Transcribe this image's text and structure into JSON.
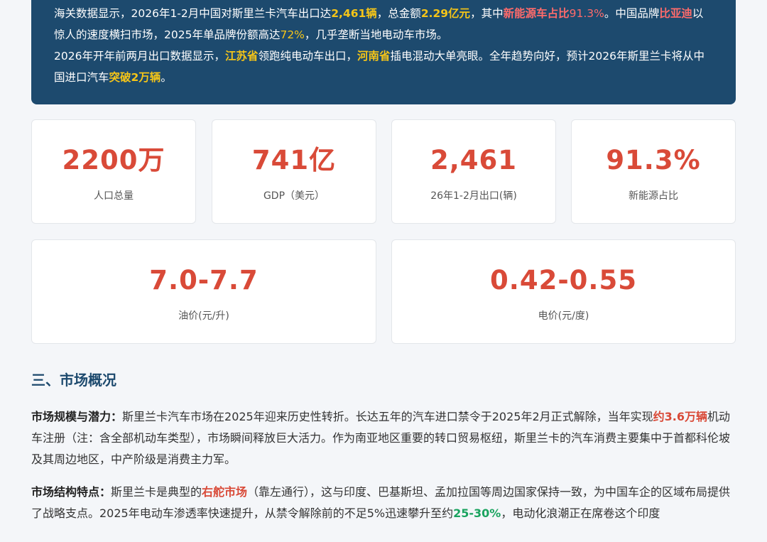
{
  "hero": {
    "p1": {
      "t1": "海关数据显示，2026年1-2月中国对斯里兰卡汽车出口达",
      "h1": "2,461辆",
      "t2": "，总金额",
      "h2": "2.29亿元",
      "t3": "，其中",
      "h3": "新能源车占比",
      "h3b": "91.3%",
      "t4": "。中国品牌",
      "h4": "比亚迪",
      "t5": "以惊人的速度横扫市场，2025年单品牌份额高达",
      "h5": "72%",
      "t6": "，几乎垄断当地电动车市场。"
    },
    "p2": {
      "t1": "2026年开年前两月出口数据显示，",
      "h1": "江苏省",
      "t2": "领跑纯电动车出口，",
      "h2": "河南省",
      "t3": "插电混动大单亮眼。全年趋势向好，预计2026年斯里兰卡将从中国进口汽车",
      "h3": "突破2万辆",
      "t4": "。"
    }
  },
  "stats": [
    {
      "value": "2200万",
      "label": "人口总量"
    },
    {
      "value": "741亿",
      "label": "GDP（美元）"
    },
    {
      "value": "2,461",
      "label": "26年1-2月出口(辆)"
    },
    {
      "value": "91.3%",
      "label": "新能源占比"
    },
    {
      "value": "7.0-7.7",
      "label": "油价(元/升)"
    },
    {
      "value": "0.42-0.55",
      "label": "电价(元/度)"
    }
  ],
  "section": {
    "title": "三、市场概况"
  },
  "para1": {
    "lead": "市场规模与潜力：",
    "t1": "斯里兰卡汽车市场在2025年迎来历史性转折。长达五年的汽车进口禁令于2025年2月正式解除，当年实现",
    "h1": "约3.6万辆",
    "t2": "机动车注册（注：含全部机动车类型），市场瞬间释放巨大活力。作为南亚地区重要的转口贸易枢纽，斯里兰卡的汽车消费主要集中于首都科伦坡及其周边地区，中产阶级是消费主力军。"
  },
  "para2": {
    "lead": "市场结构特点：",
    "t1": "斯里兰卡是典型的",
    "h1": "右舵市场",
    "t2": "（靠左通行），这与印度、巴基斯坦、孟加拉国等周边国家保持一致，为中国车企的区域布局提供了战略支点。2025年电动车渗透率快速提升，从禁令解除前的不足5%迅速攀升至约",
    "h2": "25-30%",
    "t3": "，电动化浪潮正在席卷这个印度"
  },
  "colors": {
    "hero_bg": "#1d4a6e",
    "highlight_yellow": "#f5c518",
    "highlight_red": "#ff6b6b",
    "stat_value": "#d94a38",
    "accent_green": "#1aa35f"
  }
}
